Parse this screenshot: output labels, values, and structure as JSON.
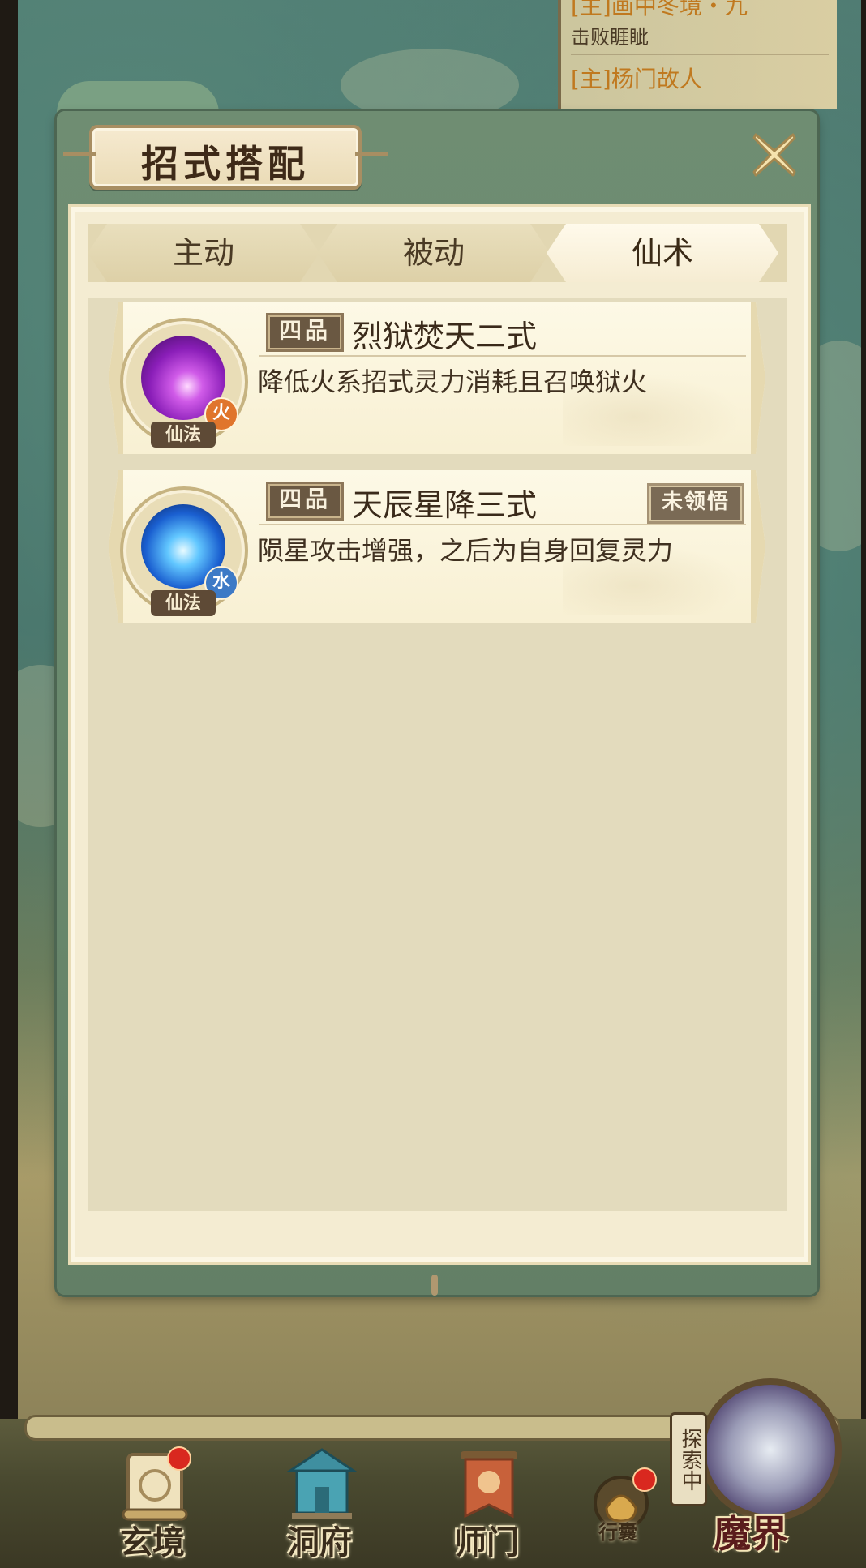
{
  "quests": [
    {
      "title": "[主]画中冬境・九",
      "subtitle": "击败睚眦"
    },
    {
      "title": "[主]杨门故人",
      "subtitle": ""
    }
  ],
  "dialog": {
    "title": "招式搭配",
    "close_icon": "close-x-icon",
    "tabs": [
      {
        "label": "主动",
        "active": false
      },
      {
        "label": "被动",
        "active": false
      },
      {
        "label": "仙术",
        "active": true
      }
    ],
    "skills": [
      {
        "grade": "四品",
        "name": "烈狱焚天二式",
        "description": "降低火系招式灵力消耗且召唤狱火",
        "type_tag": "仙法",
        "element": "火",
        "element_color": "#e0752c",
        "status": ""
      },
      {
        "grade": "四品",
        "name": "天辰星降三式",
        "description": "陨星攻击增强，之后为自身回复灵力",
        "type_tag": "仙法",
        "element": "水",
        "element_color": "#3d7ac6",
        "status": "未领悟"
      }
    ]
  },
  "bottom_nav": {
    "items": [
      {
        "label": "玄境",
        "icon": "scroll-icon",
        "badge": true
      },
      {
        "label": "洞府",
        "icon": "pavilion-icon",
        "badge": false
      },
      {
        "label": "师门",
        "icon": "banner-icon",
        "badge": false
      }
    ],
    "bag": {
      "label": "行囊",
      "icon": "pouch-icon",
      "badge": true
    },
    "explore": {
      "tag": "探索中",
      "label": "魔界",
      "icon": "demon-realm-icon"
    }
  },
  "colors": {
    "dialog_frame": "#6a8a6e",
    "paper": "#f4ecd2",
    "accent_brown": "#5e4a36"
  }
}
